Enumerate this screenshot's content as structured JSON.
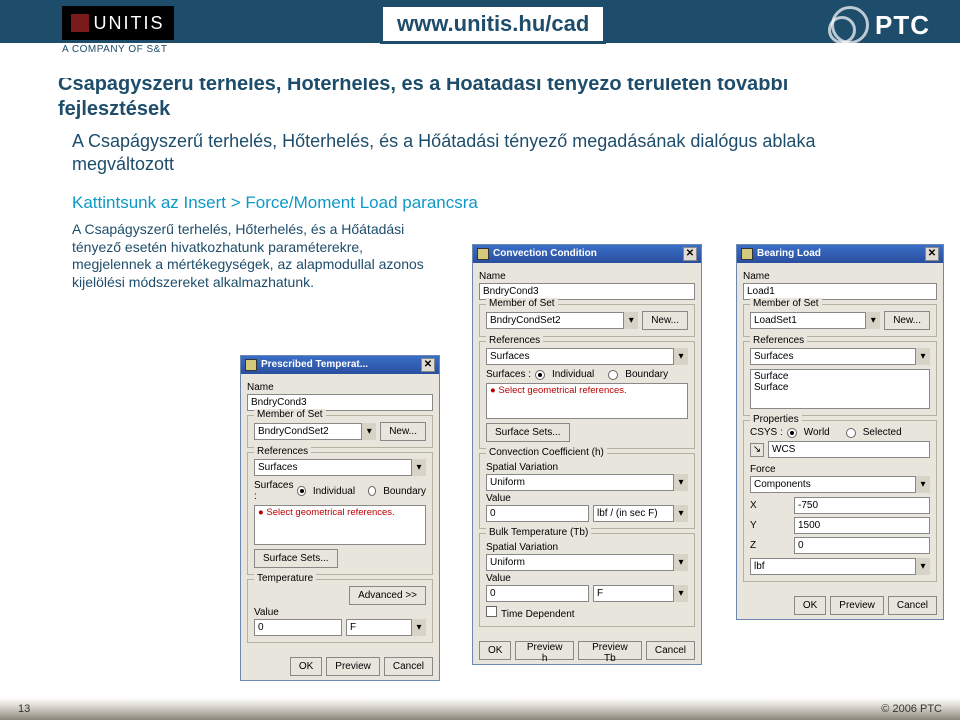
{
  "header": {
    "brand": "UNITIS",
    "brand_sub": "A COMPANY OF S&T",
    "url": "www.unitis.hu/cad",
    "ptc": "PTC"
  },
  "content": {
    "title": "Csapágyszerű terhelés, Hőterhelés, és a Hőátadási tényező területén további fejlesztések",
    "sub1": "A Csapágyszerű terhelés, Hőterhelés, és a Hőátadási tényező megadásának dialógus ablaka megváltozott",
    "sub2": "Kattintsunk az Insert > Force/Moment Load parancsra",
    "body": "A Csapágyszerű terhelés, Hőterhelés, és a Hőátadási tényező esetén hivatkozhatunk paraméterekre, megjelennek a mértékegységek, az alapmodullal azonos kijelölési módszereket alkalmazhatunk."
  },
  "dialogs": {
    "prescribed": {
      "title": "Prescribed Temperat...",
      "name_label": "Name",
      "name_value": "BndryCond3",
      "member_label": "Member of Set",
      "member_value": "BndryCondSet2",
      "new_btn": "New...",
      "refs_label": "References",
      "refs_value": "Surfaces",
      "surfaces_label": "Surfaces :",
      "radio_individual": "Individual",
      "radio_boundary": "Boundary",
      "select_msg": "Select geometrical references.",
      "surface_sets_btn": "Surface Sets...",
      "temperature_label": "Temperature",
      "advanced_btn": "Advanced >>",
      "value_label": "Value",
      "value_value": "0",
      "unit_value": "F",
      "ok": "OK",
      "preview": "Preview",
      "cancel": "Cancel"
    },
    "convection": {
      "title": "Convection Condition",
      "name_label": "Name",
      "name_value": "BndryCond3",
      "member_label": "Member of Set",
      "member_value": "BndryCondSet2",
      "new_btn": "New...",
      "refs_label": "References",
      "refs_value": "Surfaces",
      "surfaces_label": "Surfaces :",
      "radio_individual": "Individual",
      "radio_boundary": "Boundary",
      "select_msg": "Select geometrical references.",
      "surface_sets_btn": "Surface Sets...",
      "coef_label": "Convection Coefficient (h)",
      "spatial_label": "Spatial Variation",
      "spatial_value": "Uniform",
      "value_label": "Value",
      "value_value": "0",
      "value_unit": "lbf / (in sec F)",
      "bulk_label": "Bulk Temperature (Tb)",
      "bulk_spatial_label": "Spatial Variation",
      "bulk_spatial_value": "Uniform",
      "bulk_value_label": "Value",
      "bulk_value_value": "0",
      "bulk_value_unit": "F",
      "time_dep": "Time Dependent",
      "ok": "OK",
      "preview_h": "Preview h",
      "preview_tb": "Preview Tb",
      "cancel": "Cancel"
    },
    "bearing": {
      "title": "Bearing Load",
      "name_label": "Name",
      "name_value": "Load1",
      "member_label": "Member of Set",
      "member_value": "LoadSet1",
      "new_btn": "New...",
      "refs_label": "References",
      "refs_value": "Surfaces",
      "surface_item1": "Surface",
      "surface_item2": "Surface",
      "props_label": "Properties",
      "csys_label": "CSYS :",
      "radio_world": "World",
      "radio_selected": "Selected",
      "wcs_value": "WCS",
      "force_label": "Force",
      "components_value": "Components",
      "x_label": "X",
      "x_value": "-750",
      "y_label": "Y",
      "y_value": "1500",
      "z_label": "Z",
      "z_value": "0",
      "unit_value": "lbf",
      "ok": "OK",
      "preview": "Preview",
      "cancel": "Cancel"
    }
  },
  "footer": {
    "page": "13",
    "copyright": "© 2006 PTC"
  }
}
